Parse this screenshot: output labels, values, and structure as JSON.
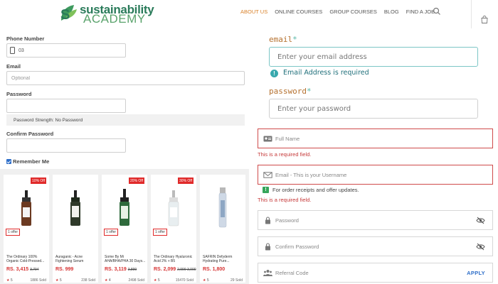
{
  "header": {
    "logo_line1": "sustainability",
    "logo_line2": "ACADEMY",
    "nav": [
      {
        "label": "ABOUT US",
        "active": true
      },
      {
        "label": "ONLINE COURSES",
        "active": false
      },
      {
        "label": "GROUP COURSES",
        "active": false
      },
      {
        "label": "BLOG",
        "active": false
      },
      {
        "label": "FIND A JOB",
        "active": false
      }
    ]
  },
  "left_form": {
    "phone_label": "Phone Number",
    "phone_value": "03",
    "email_label": "Email",
    "email_placeholder": "Optional",
    "password_label": "Password",
    "password_strength": "Password Strength: No Password",
    "confirm_label": "Confirm Password",
    "remember_label": "Remember Me"
  },
  "products": [
    {
      "badge": "10% Off",
      "offer": "1 offer",
      "title": "The Ordinary  100% Organic Cold-Pressed...",
      "price": "RS. 3,415",
      "old_price": "3,794",
      "rating": "5",
      "sold": "1886 Sold",
      "bottle_color": "#6b3a21"
    },
    {
      "badge": "",
      "offer": "",
      "title": "Auraganic - Acne Fightening Serum",
      "price": "RS. 999",
      "old_price": "",
      "rating": "5",
      "sold": "238 Sold",
      "bottle_color": "#2f3a2a"
    },
    {
      "badge": "20% Off",
      "offer": "1 offer",
      "title": "Some By Mi AHA/BHA/PHA 30 Days...",
      "price": "RS. 3,119",
      "old_price": "3,899",
      "rating": "4",
      "sold": "2498 Sold",
      "bottle_color": "#2e6a3c"
    },
    {
      "badge": "30% Off",
      "offer": "1 offer",
      "title": "The Ordinary  Hyaluronic Acid 2% + B5",
      "price": "RS. 2,099",
      "old_price": "2,999 3,000",
      "rating": "5",
      "sold": "15470 Sold",
      "bottle_color": "#e8eef0"
    },
    {
      "badge": "",
      "offer": "",
      "title": "SAFRIN  Defyderm Hydrating Pure...",
      "price": "RS. 1,800",
      "old_price": "",
      "rating": "5",
      "sold": "29 Sold",
      "bottle_color": "#cfd9e6"
    }
  ],
  "right_top": {
    "email_label": "email",
    "email_placeholder": "Enter your email address",
    "email_error": "Email Address is required",
    "password_label": "password",
    "password_placeholder": "Enter your password",
    "required_marker": "*"
  },
  "right_bottom": {
    "full_name_placeholder": "Full Name",
    "full_name_error": "This is a required field.",
    "email_placeholder": "Email - This is your Username",
    "email_hint": "For order receipts and offer updates.",
    "email_error": "This is a required field.",
    "password_placeholder": "Password",
    "confirm_placeholder": "Confirm Password",
    "referral_placeholder": "Referral Code",
    "apply_label": "APPLY"
  },
  "colors": {
    "brand_green": "#2a7b5a",
    "nav_active": "#d9822b",
    "error_red": "#cf4b4b",
    "teal_focus": "#7cc6c6",
    "label_orange": "#b5712f"
  }
}
